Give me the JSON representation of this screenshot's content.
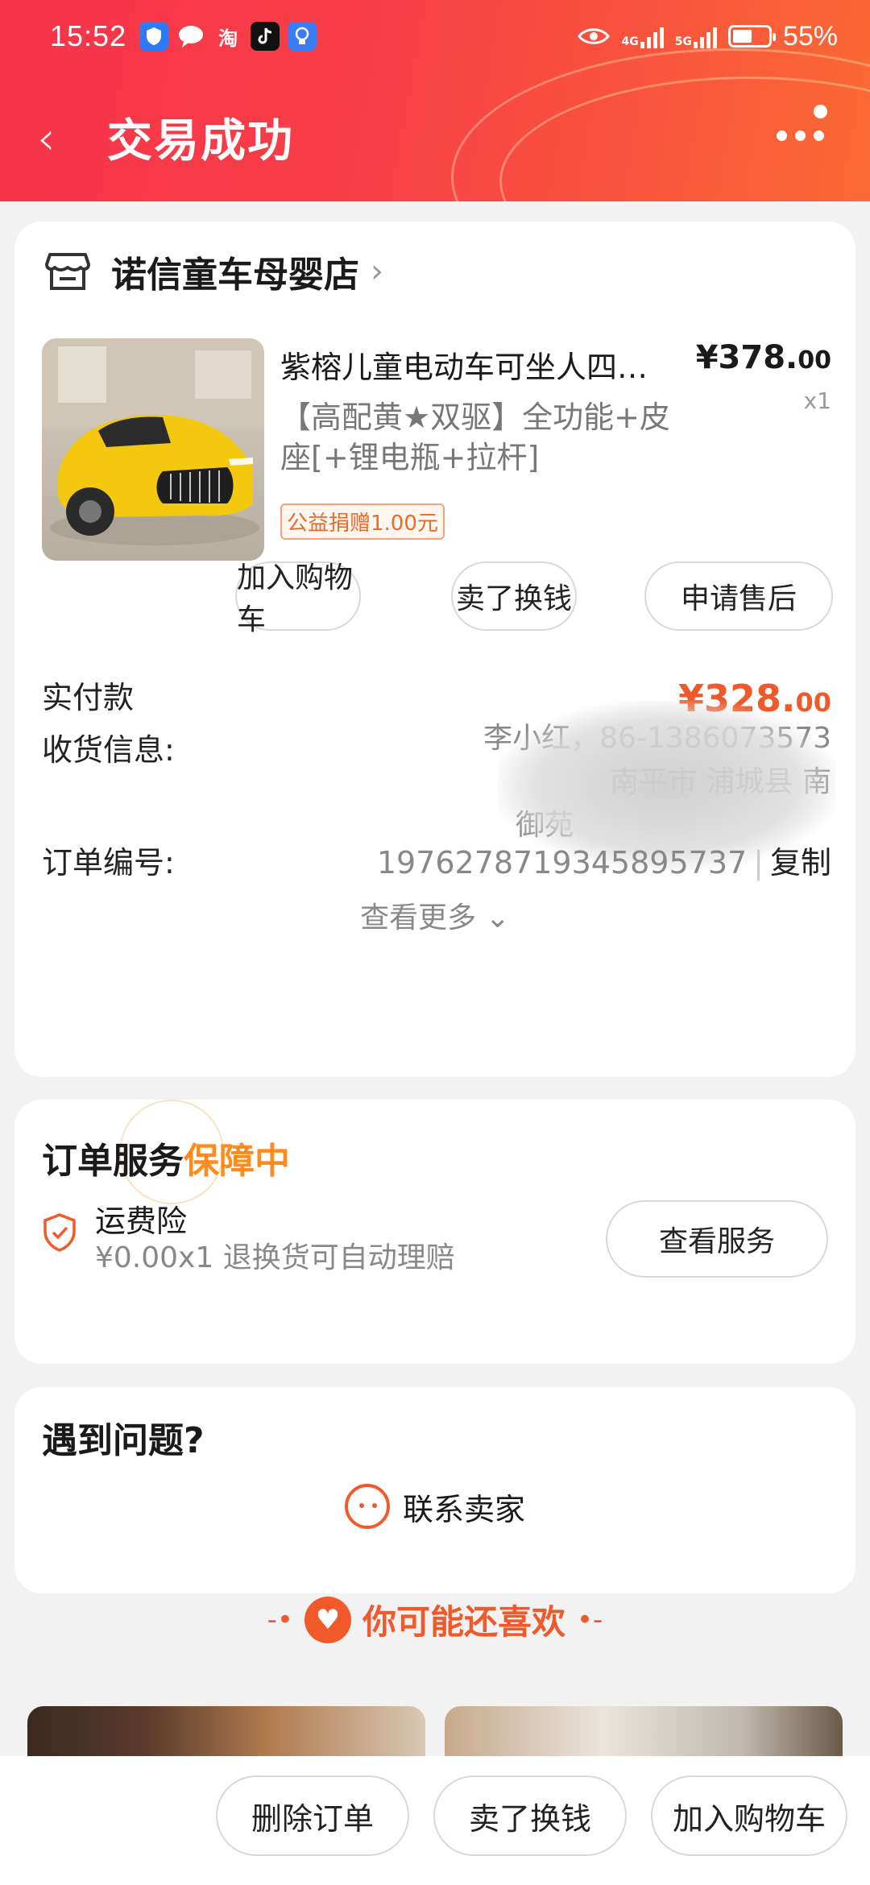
{
  "status_bar": {
    "time": "15:52",
    "app_icons": [
      "shield-app",
      "message-app",
      "taobao-app",
      "tiktok-app",
      "bulb-app"
    ],
    "taobao_glyph": "淘",
    "net_4g": "4G",
    "net_5g": "5G",
    "battery_percent": "55%",
    "battery_level": 0.55
  },
  "header": {
    "back_glyph": "‹",
    "title": "交易成功"
  },
  "order_card": {
    "shop_name": "诺信童车母婴店",
    "shop_chevron": "›",
    "product": {
      "title": "紫榕儿童电动车可坐人四…",
      "price_main": "¥378.",
      "price_cents": "00",
      "qty": "x1",
      "spec": "【高配黄★双驱】全功能+皮座[+锂电瓶+拉杆]",
      "charity_tag": "公益捐赠1.00元"
    },
    "actions": [
      "加入购物车",
      "卖了换钱",
      "申请售后"
    ],
    "paid_label": "实付款",
    "paid_main": "¥328.",
    "paid_cents": "00",
    "address_label": "收货信息:",
    "address_line1": "李小红，86-1386073573",
    "address_line2": "南平市 浦城县 南",
    "address_line3": "御苑",
    "order_no_label": "订单编号:",
    "order_no": "1976278719345895737",
    "order_sep": "|",
    "copy_label": "复制",
    "see_more": "查看更多",
    "see_more_chevron": "⌄"
  },
  "service_card": {
    "title_prefix": "订单服务",
    "title_status": "保障中",
    "service_name": "运费险",
    "service_desc": "¥0.00x1  退换货可自动理赔",
    "view_button": "查看服务"
  },
  "problem_card": {
    "title": "遇到问题?",
    "contact": "联系卖家"
  },
  "recommend": {
    "dash_left": "-•",
    "dash_right": "•-",
    "heart": "♥",
    "title": "你可能还喜欢"
  },
  "bottom_bar": {
    "buttons": [
      "删除订单",
      "卖了换钱",
      "加入购物车"
    ]
  },
  "colors": {
    "header_red": "#f7334a",
    "accent_orange": "#f05a2a",
    "guarantee_orange": "#ff8a1e"
  }
}
